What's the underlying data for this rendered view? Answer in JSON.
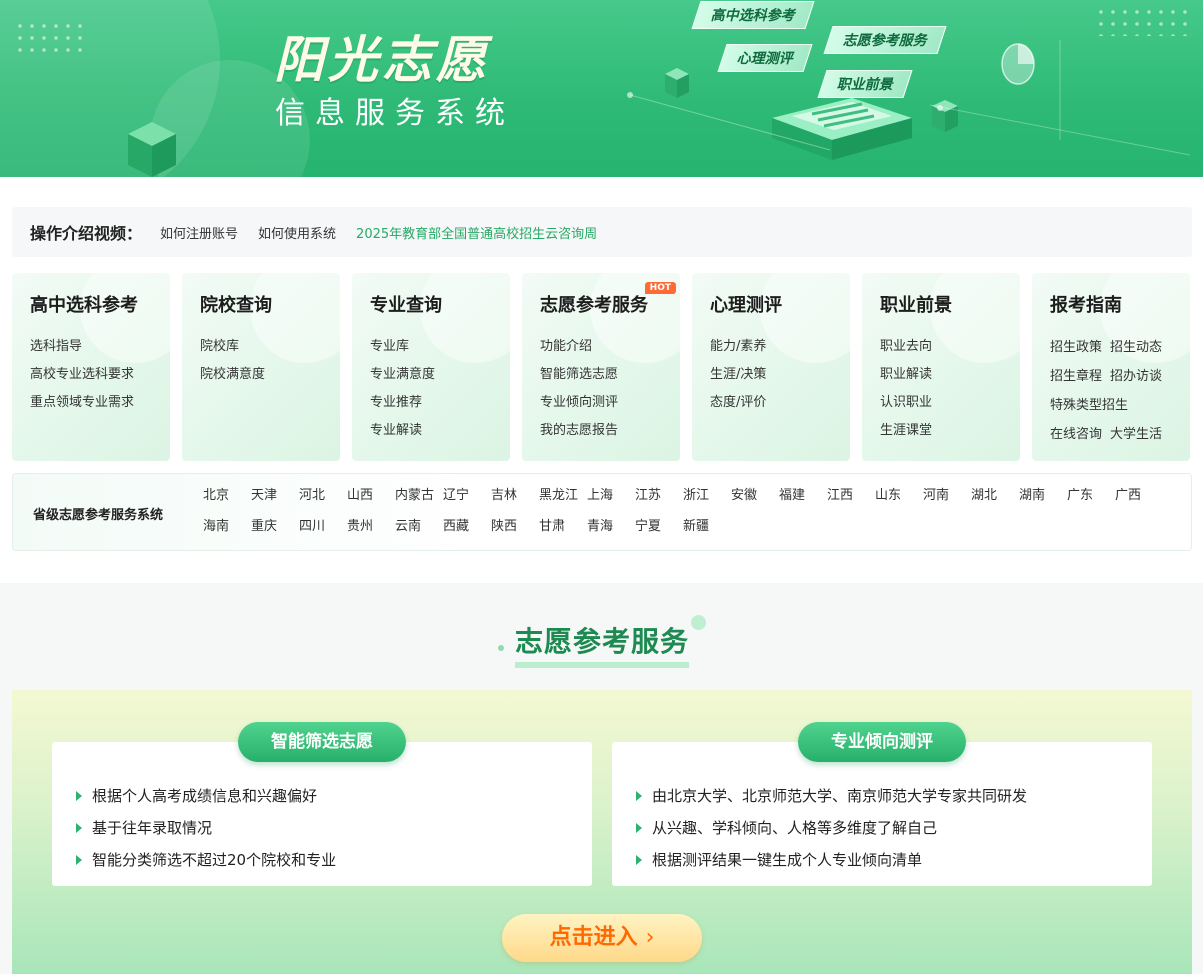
{
  "banner": {
    "title": "阳光志愿",
    "subtitle": "信息服务系统",
    "tags": [
      "高中选科参考",
      "心理测评",
      "志愿参考服务",
      "职业前景"
    ]
  },
  "intro": {
    "label": "操作介绍视频：",
    "links": [
      "如何注册账号",
      "如何使用系统",
      "2025年教育部全国普通高校招生云咨询周"
    ]
  },
  "cards": [
    {
      "title": "高中选科参考",
      "items": [
        "选科指导",
        "高校专业选科要求",
        "重点领域专业需求"
      ]
    },
    {
      "title": "院校查询",
      "items": [
        "院校库",
        "院校满意度"
      ]
    },
    {
      "title": "专业查询",
      "items": [
        "专业库",
        "专业满意度",
        "专业推荐",
        "专业解读"
      ]
    },
    {
      "title": "志愿参考服务",
      "badge": "HOT",
      "items": [
        "功能介绍",
        "智能筛选志愿",
        "专业倾向测评",
        "我的志愿报告"
      ]
    },
    {
      "title": "心理测评",
      "items": [
        "能力/素养",
        "生涯/决策",
        "态度/评价"
      ]
    },
    {
      "title": "职业前景",
      "items": [
        "职业去向",
        "职业解读",
        "认识职业",
        "生涯课堂"
      ]
    },
    {
      "title": "报考指南",
      "items": [
        "招生政策",
        "招生动态",
        "招生章程",
        "招办访谈",
        "特殊类型招生",
        "在线咨询",
        "大学生活"
      ]
    }
  ],
  "province": {
    "label": "省级志愿参考服务系统",
    "items": [
      "北京",
      "天津",
      "河北",
      "山西",
      "内蒙古",
      "辽宁",
      "吉林",
      "黑龙江",
      "上海",
      "江苏",
      "浙江",
      "安徽",
      "福建",
      "江西",
      "山东",
      "河南",
      "湖北",
      "湖南",
      "广东",
      "广西",
      "海南",
      "重庆",
      "四川",
      "贵州",
      "云南",
      "西藏",
      "陕西",
      "甘肃",
      "青海",
      "宁夏",
      "新疆"
    ]
  },
  "service": {
    "title": "志愿参考服务",
    "left": {
      "name": "智能筛选志愿",
      "points": [
        "根据个人高考成绩信息和兴趣偏好",
        "基于往年录取情况",
        "智能分类筛选不超过20个院校和专业"
      ]
    },
    "right": {
      "name": "专业倾向测评",
      "points": [
        "由北京大学、北京师范大学、南京师范大学专家共同研发",
        "从兴趣、学科倾向、人格等多维度了解自己",
        "根据测评结果一键生成个人专业倾向清单"
      ]
    },
    "enter_label": "点击进入",
    "enter_icon": "chevron-right-icon"
  }
}
